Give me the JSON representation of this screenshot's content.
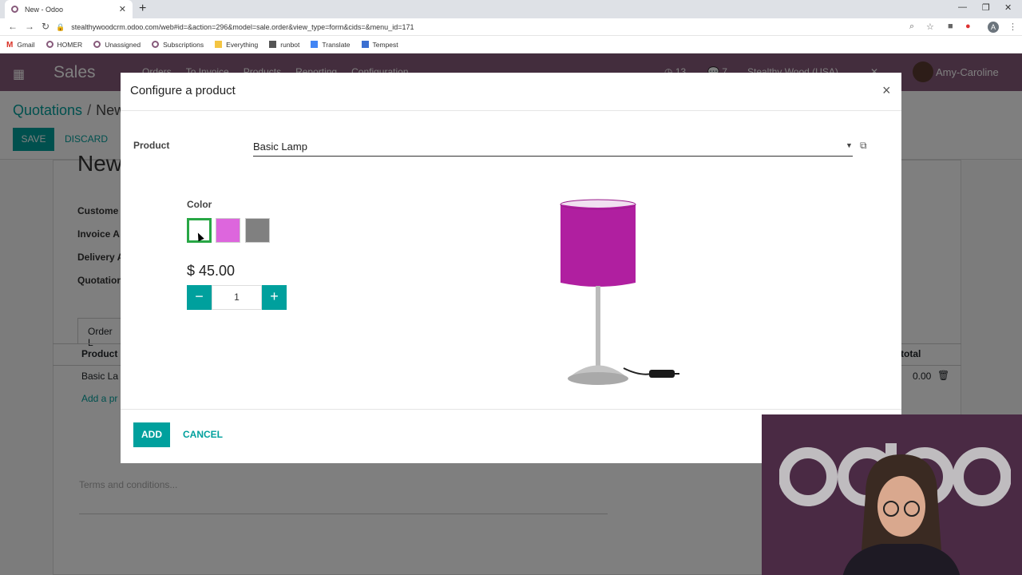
{
  "browser": {
    "tab_title": "New - Odoo",
    "url": "stealthywoodcrm.odoo.com/web#id=&action=296&model=sale.order&view_type=form&cids=&menu_id=171",
    "bookmarks": [
      "Gmail",
      "HOMER",
      "Unassigned",
      "Subscriptions",
      "Everything",
      "runbot",
      "Translate",
      "Tempest"
    ],
    "profile_initial": "A"
  },
  "odoo": {
    "app_name": "Sales",
    "menu": [
      "Orders",
      "To Invoice",
      "Products",
      "Reporting",
      "Configuration"
    ],
    "activity_count": "13",
    "message_count": "7",
    "company": "Stealthy Wood (USA)",
    "user": "Amy-Caroline",
    "breadcrumb": [
      "Quotations",
      "New"
    ],
    "save_label": "SAVE",
    "discard_label": "DISCARD",
    "sheet_title": "New",
    "fields": [
      "Custome",
      "Invoice A",
      "Delivery A",
      "Quotation"
    ],
    "order_tab": "Order L",
    "table_header_product": "Product",
    "table_header_subtotal": "total",
    "row_product": "Basic La",
    "row_subtotal": "0.00",
    "add_line": "Add a pr",
    "terms_placeholder": "Terms and conditions..."
  },
  "modal": {
    "title": "Configure a product",
    "product_label": "Product",
    "product_value": "Basic Lamp",
    "attribute_label": "Color",
    "swatches": [
      {
        "name": "White",
        "color": "#ffffff",
        "selected": true
      },
      {
        "name": "Pink",
        "color": "#dd66dd",
        "selected": false
      },
      {
        "name": "Grey",
        "color": "#808080",
        "selected": false
      }
    ],
    "price": "$ 45.00",
    "quantity": "1",
    "add_label": "ADD",
    "cancel_label": "CANCEL",
    "lamp_shade_color": "#b01fa0"
  },
  "colors": {
    "primary": "#00a09d",
    "brand": "#875a7b"
  }
}
